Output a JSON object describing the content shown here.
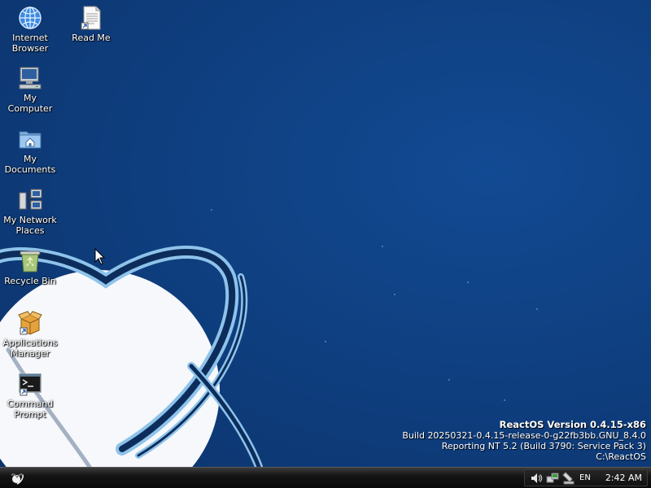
{
  "desktop": {
    "icons": [
      {
        "label_line1": "Internet",
        "label_line2": "Browser",
        "icon": "globe-icon"
      },
      {
        "label_line1": "Read Me",
        "label_line2": "",
        "icon": "document-icon"
      },
      {
        "label_line1": "My",
        "label_line2": "Computer",
        "icon": "computer-icon"
      },
      {
        "label_line1": "My",
        "label_line2": "Documents",
        "icon": "folder-home-icon"
      },
      {
        "label_line1": "My Network",
        "label_line2": "Places",
        "icon": "network-icon"
      },
      {
        "label_line1": "Recycle Bin",
        "label_line2": "",
        "icon": "recycle-bin-icon"
      },
      {
        "label_line1": "Applications",
        "label_line2": "Manager",
        "icon": "package-icon"
      },
      {
        "label_line1": "Command",
        "label_line2": "Prompt",
        "icon": "terminal-icon"
      }
    ],
    "version_info": {
      "title": "ReactOS Version 0.4.15-x86",
      "build": "Build 20250321-0.4.15-release-0-g22fb3bb.GNU_8.4.0",
      "reporting": "Reporting NT 5.2 (Build 3790: Service Pack 3)",
      "path": "C:\\ReactOS"
    }
  },
  "taskbar": {
    "start_icon": "reactos-logo-icon",
    "tray": {
      "icons": [
        "volume-icon",
        "network-status-icon",
        "safely-remove-icon"
      ],
      "language": "EN",
      "clock": "2:42 AM"
    }
  },
  "colors": {
    "desktop_bg": "#0f3f80",
    "taskbar_bg": "#111111",
    "text": "#ffffff"
  }
}
